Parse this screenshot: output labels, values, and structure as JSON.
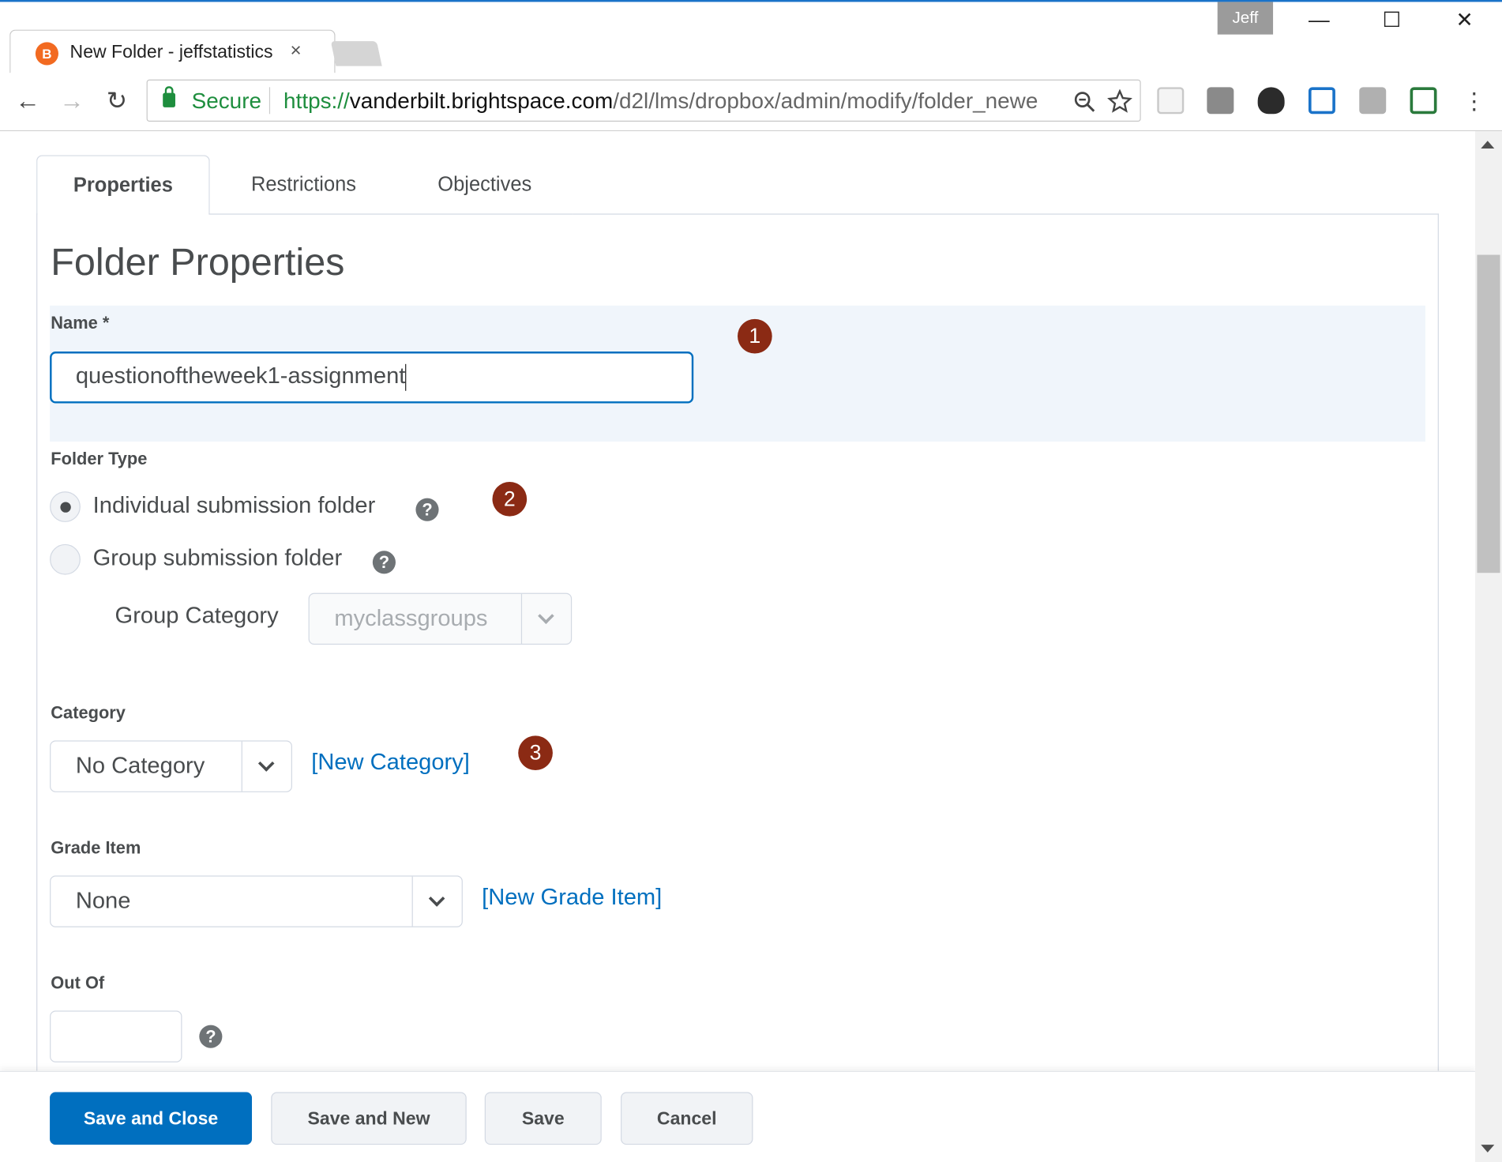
{
  "browser": {
    "tab_title": "New Folder - jeffstatistics",
    "tab_close": "×",
    "profile_name": "Jeff",
    "window_controls": {
      "minimize": "—",
      "maximize": "☐",
      "close": "✕"
    },
    "nav": {
      "back": "←",
      "forward": "→",
      "reload": "↻"
    },
    "secure_label": "Secure",
    "url_scheme": "https://",
    "url_host": "vanderbilt.brightspace.com",
    "url_path": "/d2l/lms/dropbox/admin/modify/folder_newe",
    "zoom_icon": "zoom-icon",
    "star_icon": "star-icon",
    "menu_icon": "⋮"
  },
  "tabs": [
    {
      "label": "Properties",
      "active": true
    },
    {
      "label": "Restrictions",
      "active": false
    },
    {
      "label": "Objectives",
      "active": false
    }
  ],
  "form": {
    "heading": "Folder Properties",
    "name_label": "Name *",
    "name_value": "questionoftheweek1-assignment",
    "folder_type_label": "Folder Type",
    "folder_types": [
      {
        "label": "Individual submission folder",
        "checked": true
      },
      {
        "label": "Group submission folder",
        "checked": false
      }
    ],
    "group_category_label": "Group Category",
    "group_category_value": "myclassgroups",
    "category_label": "Category",
    "category_value": "No Category",
    "new_category_link": "[New Category]",
    "grade_item_label": "Grade Item",
    "grade_item_value": "None",
    "new_grade_item_link": "[New Grade Item]",
    "out_of_label": "Out Of",
    "out_of_value": "",
    "help_glyph": "?"
  },
  "badges": [
    "1",
    "2",
    "3"
  ],
  "buttons": {
    "save_and_close": "Save and Close",
    "save_and_new": "Save and New",
    "save": "Save",
    "cancel": "Cancel"
  },
  "colors": {
    "primary": "#006fbf",
    "badge": "#8b2a14",
    "secure_green": "#1e8e3e",
    "text": "#494c4e"
  }
}
